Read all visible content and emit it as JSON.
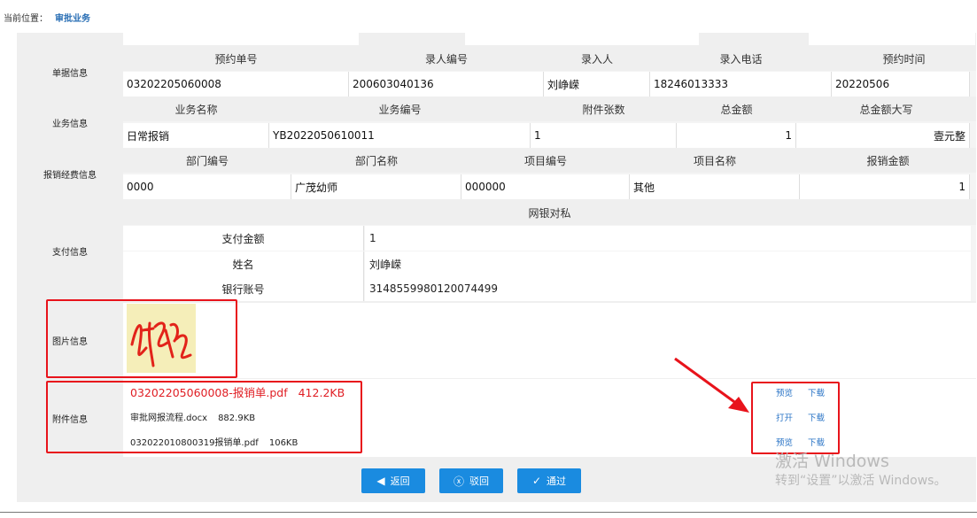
{
  "breadcrumb": {
    "label": "当前位置：",
    "current": "审批业务"
  },
  "sections": {
    "danju": {
      "label": "单据信息",
      "headers": [
        "预约单号",
        "录人编号",
        "录入人",
        "录入电话",
        "预约时间"
      ],
      "values": [
        "03202205060008",
        "200603040136",
        "刘峥嵘",
        "18246013333",
        "20220506"
      ]
    },
    "yewu": {
      "label": "业务信息",
      "headers": [
        "业务名称",
        "业务编号",
        "附件张数",
        "总金额",
        "总金额大写"
      ],
      "values": [
        "日常报销",
        "YB2022050610011",
        "1",
        "1",
        "壹元整"
      ]
    },
    "baoxiao": {
      "label": "报销经费信息",
      "headers": [
        "部门编号",
        "部门名称",
        "项目编号",
        "项目名称",
        "报销金额"
      ],
      "values": [
        "0000",
        "广茂幼师",
        "000000",
        "其他",
        "1"
      ]
    },
    "zhifu": {
      "label": "支付信息",
      "method": "网银对私",
      "rows": [
        {
          "key": "支付金额",
          "value": "1"
        },
        {
          "key": "姓名",
          "value": "刘峥嵘"
        },
        {
          "key": "银行账号",
          "value": "3148559980120074499"
        }
      ]
    },
    "tupian": {
      "label": "图片信息"
    },
    "fujian": {
      "label": "附件信息",
      "files": [
        {
          "name": "03202205060008-报销单.pdf",
          "size": "412.2KB",
          "actions": [
            "预览",
            "下载"
          ]
        },
        {
          "name": "审批网报流程.docx",
          "size": "882.9KB",
          "actions": [
            "打开",
            "下载"
          ]
        },
        {
          "name": "032022010800319报销单.pdf",
          "size": "106KB",
          "actions": [
            "预览",
            "下载"
          ]
        }
      ]
    }
  },
  "buttons": {
    "back": "返回",
    "reject": "驳回",
    "approve": "通过"
  },
  "watermark": {
    "line1": "激活 Windows",
    "line2": "转到“设置”以激活 Windows。"
  },
  "colors": {
    "annotation_red": "#e8131b",
    "button_blue": "#1a8be0",
    "link_blue": "#2a74c6"
  }
}
